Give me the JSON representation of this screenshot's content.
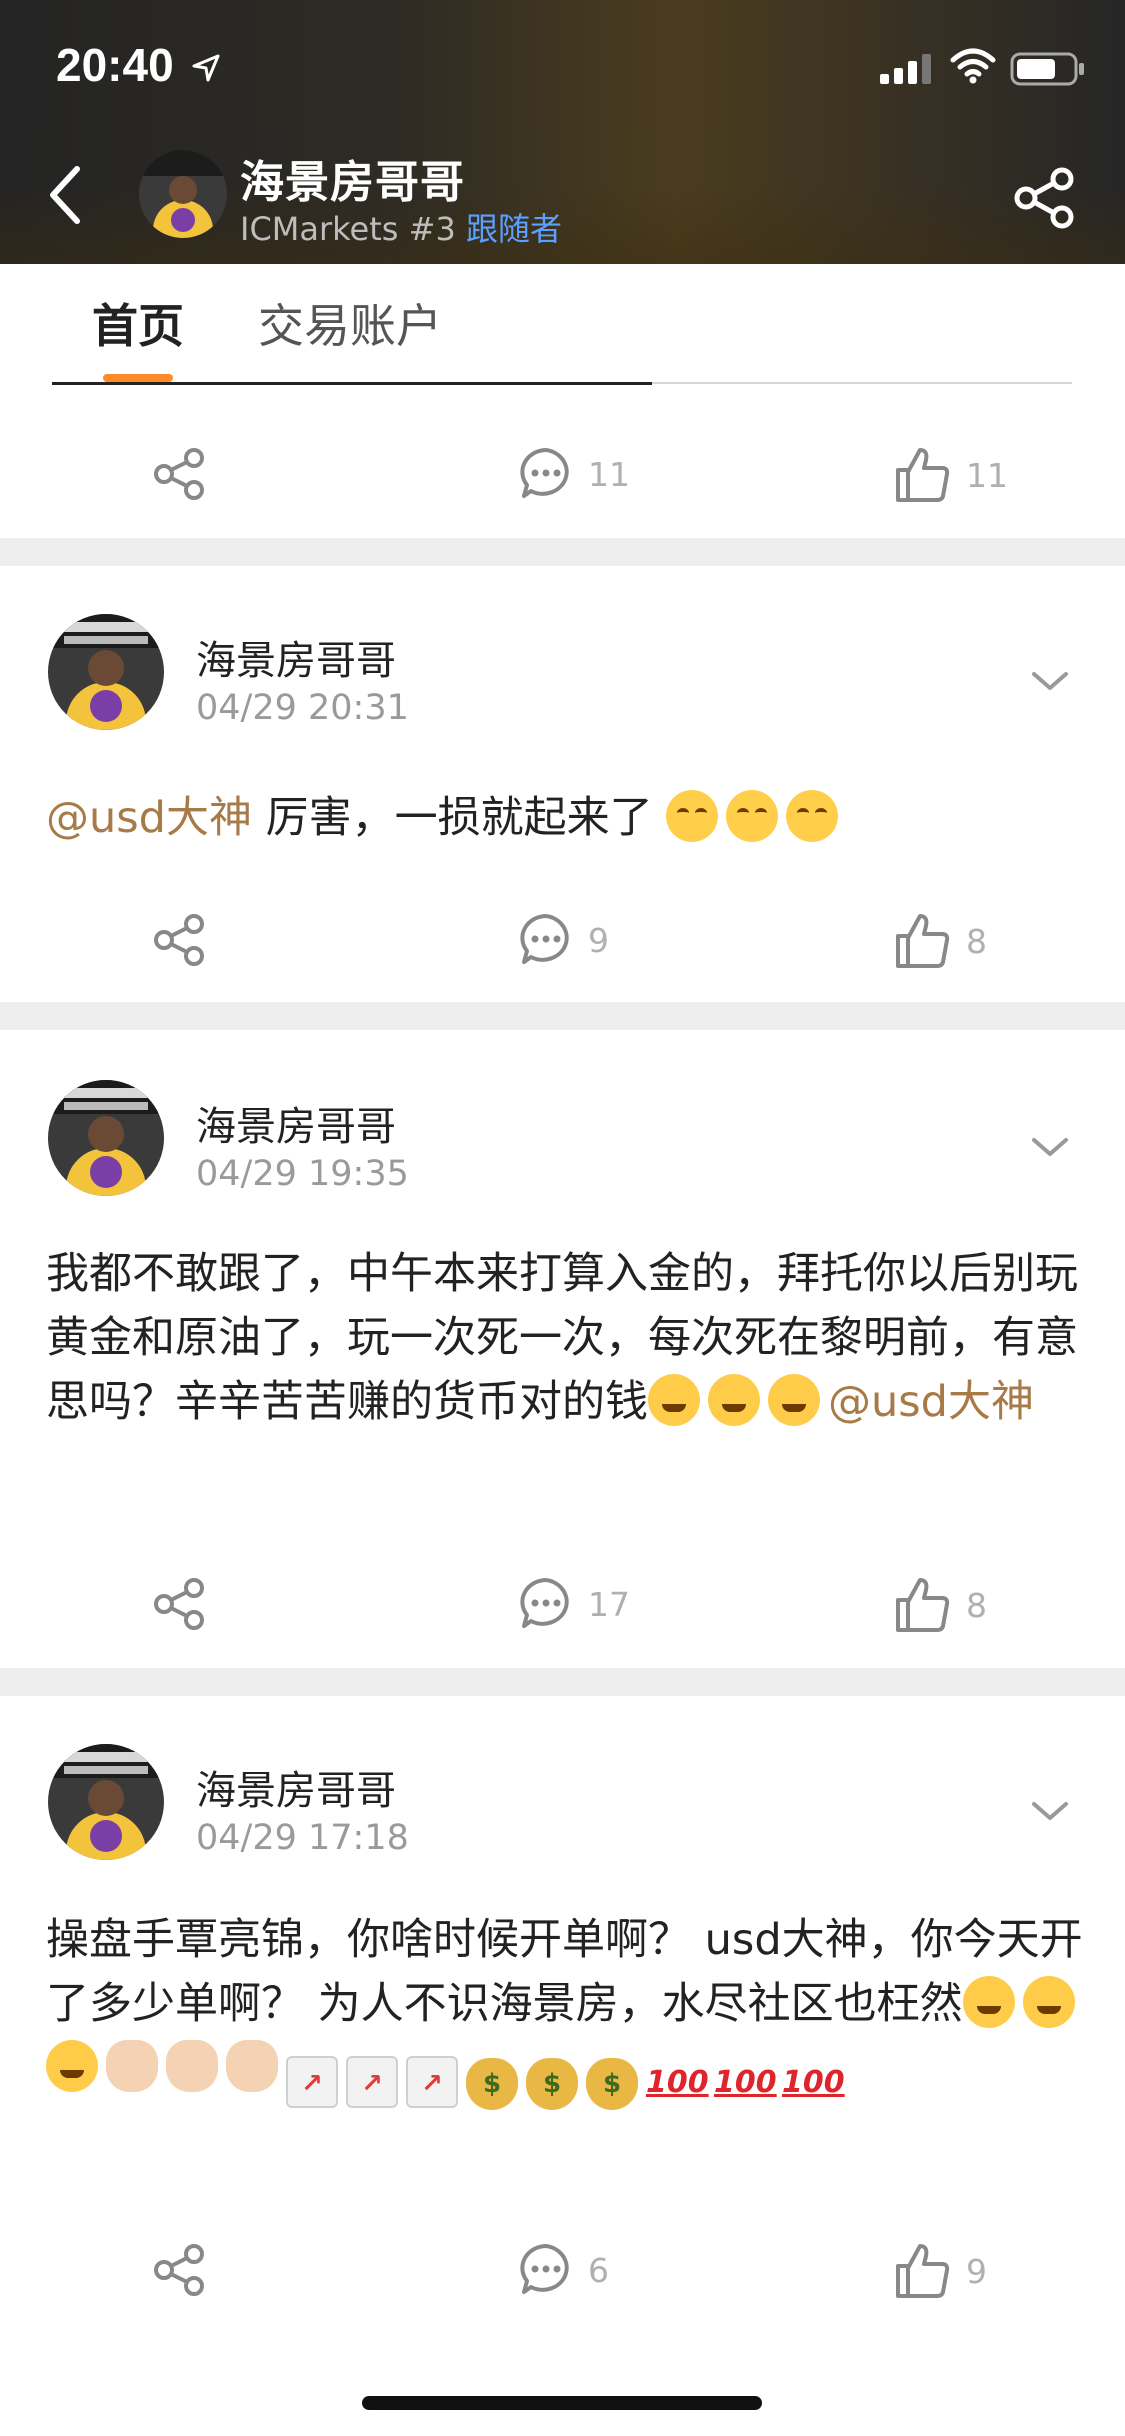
{
  "status_bar": {
    "time": "20:40"
  },
  "header": {
    "name": "海景房哥哥",
    "broker": "ICMarkets",
    "rank": "#3",
    "follower_label": "跟随者"
  },
  "tabs": [
    {
      "label": "首页",
      "active": true
    },
    {
      "label": "交易账户",
      "active": false
    }
  ],
  "colors": {
    "accent": "#ff8a2a",
    "mention": "#a77a47",
    "follower_link": "#5aa0ff"
  },
  "first_card_actions": {
    "comments": "11",
    "likes": "11"
  },
  "posts": [
    {
      "author": "海景房哥哥",
      "time": "04/29 20:31",
      "mention": "@usd大神",
      "text": "厉害，一损就起来了",
      "emojis": [
        "😂",
        "😂",
        "😂"
      ],
      "comments": "9",
      "likes": "8"
    },
    {
      "author": "海景房哥哥",
      "time": "04/29 19:35",
      "text": "我都不敢跟了，中午本来打算入金的，拜托你以后别玩黄金和原油了，玩一次死一次，每次死在黎明前，有意思吗？辛辛苦苦赚的货币对的钱",
      "emojis": [
        "😤",
        "😤",
        "😤"
      ],
      "mention": "@usd大神",
      "comments": "17",
      "likes": "8"
    },
    {
      "author": "海景房哥哥",
      "time": "04/29 17:18",
      "text": "操盘手覃亮锦，你啥时候开单啊？ usd大神，你今天开了多少单啊？ 为人不识海景房，水尽社区也枉然",
      "emojis": [
        "😤",
        "😤",
        "😤",
        "👏",
        "👏",
        "👏",
        "📈",
        "📈",
        "📈",
        "💰",
        "💰",
        "💰",
        "💯",
        "💯",
        "💯"
      ],
      "comments": "6",
      "likes": "9"
    }
  ]
}
